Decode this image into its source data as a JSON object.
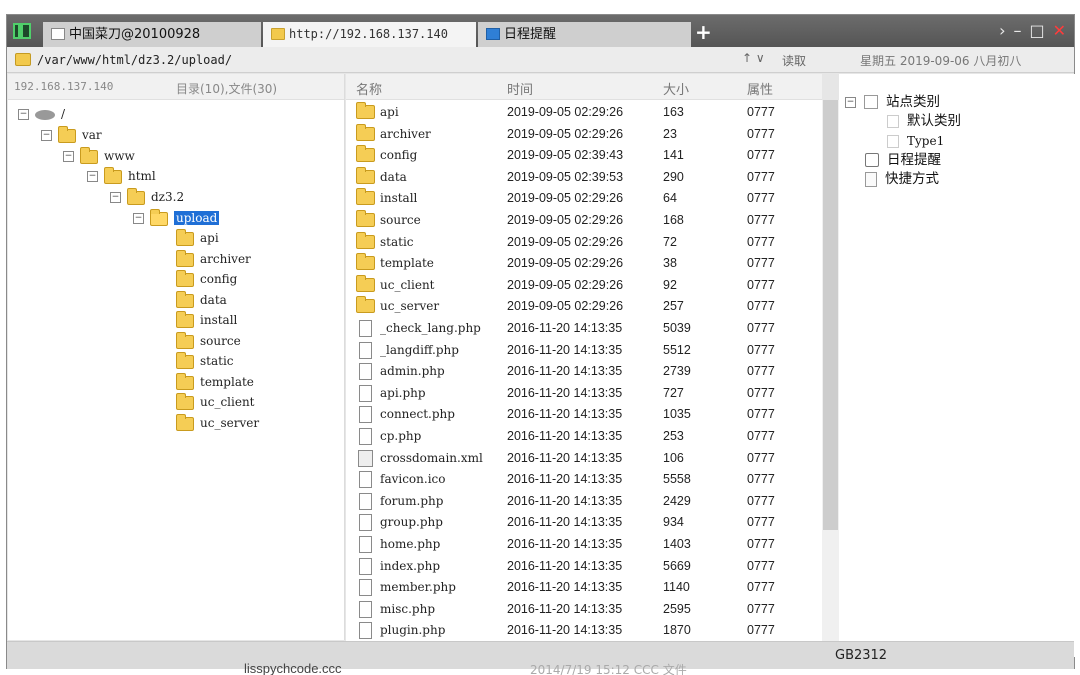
{
  "tabs": [
    {
      "label": "中国菜刀@20100928"
    },
    {
      "label": "http://192.168.137.140"
    },
    {
      "label": "日程提醒"
    }
  ],
  "address": {
    "path": "/var/www/html/dz3.2/upload/",
    "read_label": "读取",
    "date": "星期五 2019-09-06 八月初八"
  },
  "left_pane": {
    "host": "192.168.137.140",
    "counts": "目录(10),文件(30)",
    "tree": [
      "/",
      "var",
      "www",
      "html",
      "dz3.2",
      "upload",
      "api",
      "archiver",
      "config",
      "data",
      "install",
      "source",
      "static",
      "template",
      "uc_client",
      "uc_server"
    ]
  },
  "file_list": {
    "headers": {
      "name": "名称",
      "time": "时间",
      "size": "大小",
      "attr": "属性"
    },
    "rows": [
      {
        "name": "api",
        "time": "2019-09-05 02:29:26",
        "size": "163",
        "attr": "0777",
        "type": "dir"
      },
      {
        "name": "archiver",
        "time": "2019-09-05 02:29:26",
        "size": "23",
        "attr": "0777",
        "type": "dir"
      },
      {
        "name": "config",
        "time": "2019-09-05 02:39:43",
        "size": "141",
        "attr": "0777",
        "type": "dir"
      },
      {
        "name": "data",
        "time": "2019-09-05 02:39:53",
        "size": "290",
        "attr": "0777",
        "type": "dir"
      },
      {
        "name": "install",
        "time": "2019-09-05 02:29:26",
        "size": "64",
        "attr": "0777",
        "type": "dir"
      },
      {
        "name": "source",
        "time": "2019-09-05 02:29:26",
        "size": "168",
        "attr": "0777",
        "type": "dir"
      },
      {
        "name": "static",
        "time": "2019-09-05 02:29:26",
        "size": "72",
        "attr": "0777",
        "type": "dir"
      },
      {
        "name": "template",
        "time": "2019-09-05 02:29:26",
        "size": "38",
        "attr": "0777",
        "type": "dir"
      },
      {
        "name": "uc_client",
        "time": "2019-09-05 02:29:26",
        "size": "92",
        "attr": "0777",
        "type": "dir"
      },
      {
        "name": "uc_server",
        "time": "2019-09-05 02:29:26",
        "size": "257",
        "attr": "0777",
        "type": "dir"
      },
      {
        "name": "_check_lang.php",
        "time": "2016-11-20 14:13:35",
        "size": "5039",
        "attr": "0777",
        "type": "file"
      },
      {
        "name": "_langdiff.php",
        "time": "2016-11-20 14:13:35",
        "size": "5512",
        "attr": "0777",
        "type": "file"
      },
      {
        "name": "admin.php",
        "time": "2016-11-20 14:13:35",
        "size": "2739",
        "attr": "0777",
        "type": "file"
      },
      {
        "name": "api.php",
        "time": "2016-11-20 14:13:35",
        "size": "727",
        "attr": "0777",
        "type": "file"
      },
      {
        "name": "connect.php",
        "time": "2016-11-20 14:13:35",
        "size": "1035",
        "attr": "0777",
        "type": "file"
      },
      {
        "name": "cp.php",
        "time": "2016-11-20 14:13:35",
        "size": "253",
        "attr": "0777",
        "type": "file"
      },
      {
        "name": "crossdomain.xml",
        "time": "2016-11-20 14:13:35",
        "size": "106",
        "attr": "0777",
        "type": "xml"
      },
      {
        "name": "favicon.ico",
        "time": "2016-11-20 14:13:35",
        "size": "5558",
        "attr": "0777",
        "type": "file"
      },
      {
        "name": "forum.php",
        "time": "2016-11-20 14:13:35",
        "size": "2429",
        "attr": "0777",
        "type": "file"
      },
      {
        "name": "group.php",
        "time": "2016-11-20 14:13:35",
        "size": "934",
        "attr": "0777",
        "type": "file"
      },
      {
        "name": "home.php",
        "time": "2016-11-20 14:13:35",
        "size": "1403",
        "attr": "0777",
        "type": "file"
      },
      {
        "name": "index.php",
        "time": "2016-11-20 14:13:35",
        "size": "5669",
        "attr": "0777",
        "type": "file"
      },
      {
        "name": "member.php",
        "time": "2016-11-20 14:13:35",
        "size": "1140",
        "attr": "0777",
        "type": "file"
      },
      {
        "name": "misc.php",
        "time": "2016-11-20 14:13:35",
        "size": "2595",
        "attr": "0777",
        "type": "file"
      },
      {
        "name": "plugin.php",
        "time": "2016-11-20 14:13:35",
        "size": "1870",
        "attr": "0777",
        "type": "file"
      }
    ]
  },
  "right_pane": {
    "site_category": "站点类别",
    "default_category": "默认类别",
    "type1": "Type1",
    "schedule": "日程提醒",
    "shortcuts": "快捷方式"
  },
  "status": {
    "encoding": "GB2312"
  },
  "background": {
    "behind_text": "lisspychcode.ccc",
    "behind_meta": "2014/7/19 15:12    CCC 文件"
  },
  "colors": {
    "selection": "#1f6fd6",
    "folder": "#f5cd55",
    "close": "#ff3b3b"
  }
}
